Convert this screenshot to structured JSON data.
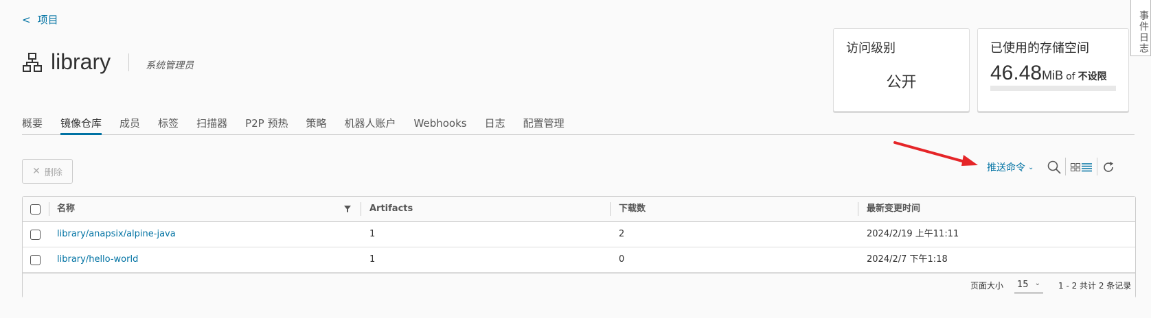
{
  "nav": {
    "back_label": "项目"
  },
  "project": {
    "name": "library",
    "role": "系统管理员"
  },
  "cards": {
    "access": {
      "title": "访问级别",
      "value": "公开"
    },
    "storage": {
      "title": "已使用的存储空间",
      "amount": "46.48",
      "unit": "MiB",
      "of": "of",
      "limit": "不设限",
      "usage_fraction": 0
    }
  },
  "side_tab": {
    "label": "事件日志"
  },
  "tabs": [
    {
      "label": "概要"
    },
    {
      "label": "镜像仓库",
      "active": true
    },
    {
      "label": "成员"
    },
    {
      "label": "标签"
    },
    {
      "label": "扫描器"
    },
    {
      "label": "P2P 预热"
    },
    {
      "label": "策略"
    },
    {
      "label": "机器人账户"
    },
    {
      "label": "Webhooks"
    },
    {
      "label": "日志"
    },
    {
      "label": "配置管理"
    }
  ],
  "actions": {
    "delete_label": "删除",
    "push_command_label": "推送命令"
  },
  "icons": {
    "project": "project-tree-icon",
    "search": "search-icon",
    "grid_view": "grid-view-icon",
    "list_view": "list-view-icon",
    "refresh": "refresh-icon",
    "filter": "filter-icon",
    "annotation": "red-arrow"
  },
  "colors": {
    "accent": "#0072a3",
    "annotation_arrow": "#e52528"
  },
  "table": {
    "columns": [
      "名称",
      "Artifacts",
      "下载数",
      "最新变更时间"
    ],
    "rows": [
      {
        "name": "library/anapsix/alpine-java",
        "artifacts": "1",
        "downloads": "2",
        "updated": "2024/2/19 上午11:11"
      },
      {
        "name": "library/hello-world",
        "artifacts": "1",
        "downloads": "0",
        "updated": "2024/2/7 下午1:18"
      }
    ],
    "footer": {
      "page_size_label": "页面大小",
      "page_size": "15",
      "range_text": "1 - 2 共计 2 条记录"
    }
  }
}
